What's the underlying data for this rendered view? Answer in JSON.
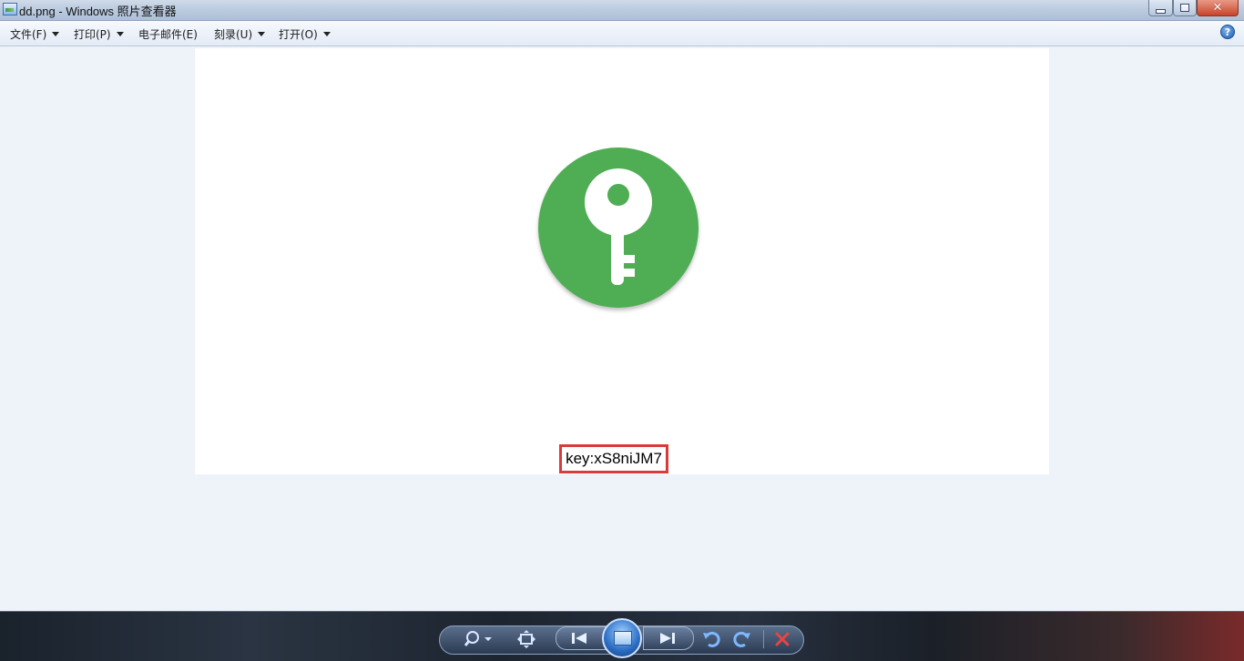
{
  "window": {
    "title": "dd.png - Windows 照片查看器",
    "controls": {
      "minimize": "minimize",
      "maximize": "restore",
      "close": "close"
    }
  },
  "menubar": {
    "items": [
      {
        "label": "文件(F)",
        "has_dropdown": true
      },
      {
        "label": "打印(P)",
        "has_dropdown": true
      },
      {
        "label": "电子邮件(E)",
        "has_dropdown": false
      },
      {
        "label": "刻录(U)",
        "has_dropdown": true
      },
      {
        "label": "打开(O)",
        "has_dropdown": true
      }
    ],
    "help_label": "?"
  },
  "image": {
    "icon": "key-icon",
    "icon_color": "#4fad54",
    "caption": "key:xS8niJM7",
    "caption_border_color": "#d93b3b"
  },
  "controlbar": {
    "buttons": [
      {
        "name": "zoom-button",
        "icon": "magnifier-icon"
      },
      {
        "name": "actual-size-button",
        "icon": "fit-window-icon"
      },
      {
        "name": "previous-button",
        "icon": "skip-previous-icon"
      },
      {
        "name": "slideshow-button",
        "icon": "slideshow-icon"
      },
      {
        "name": "next-button",
        "icon": "skip-next-icon"
      },
      {
        "name": "rotate-counterclockwise-button",
        "icon": "rotate-left-icon"
      },
      {
        "name": "rotate-clockwise-button",
        "icon": "rotate-right-icon"
      },
      {
        "name": "delete-button",
        "icon": "delete-icon"
      }
    ]
  }
}
